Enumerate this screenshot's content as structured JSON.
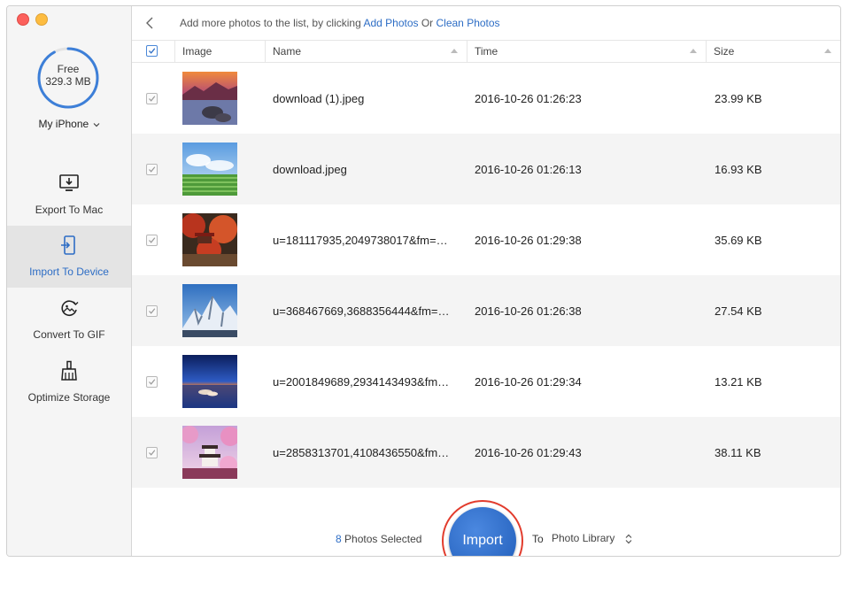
{
  "sidebar": {
    "storage_label": "Free",
    "storage_value": "329.3 MB",
    "storage_used_fraction": 0.92,
    "device_name": "My iPhone",
    "items": [
      {
        "label": "Export To Mac"
      },
      {
        "label": "Import To Device"
      },
      {
        "label": "Convert To GIF"
      },
      {
        "label": "Optimize Storage"
      }
    ]
  },
  "topbar": {
    "hint_prefix": "Add more photos to the list, by clicking ",
    "add_photos": "Add Photos",
    "or": " Or ",
    "clean_photos": "Clean Photos"
  },
  "table": {
    "columns": [
      "Image",
      "Name",
      "Time",
      "Size"
    ],
    "rows": [
      {
        "name": "download (1).jpeg",
        "time": "2016-10-26 01:26:23",
        "size": "23.99 KB"
      },
      {
        "name": "download.jpeg",
        "time": "2016-10-26 01:26:13",
        "size": "16.93 KB"
      },
      {
        "name": "u=181117935,2049738017&fm=…",
        "time": "2016-10-26 01:29:38",
        "size": "35.69 KB"
      },
      {
        "name": "u=368467669,3688356444&fm=…",
        "time": "2016-10-26 01:26:38",
        "size": "27.54 KB"
      },
      {
        "name": "u=2001849689,2934143493&fm…",
        "time": "2016-10-26 01:29:34",
        "size": "13.21 KB"
      },
      {
        "name": "u=2858313701,4108436550&fm…",
        "time": "2016-10-26 01:29:43",
        "size": "38.11 KB"
      }
    ]
  },
  "footer": {
    "selected_count": "8",
    "selected_label": " Photos Selected",
    "import_label": "Import",
    "to_label": "To",
    "destination": "Photo Library"
  },
  "colors": {
    "accent": "#2d6dc5",
    "import_ring": "#e23c2d",
    "storage_ring": "#3d7fd8"
  }
}
